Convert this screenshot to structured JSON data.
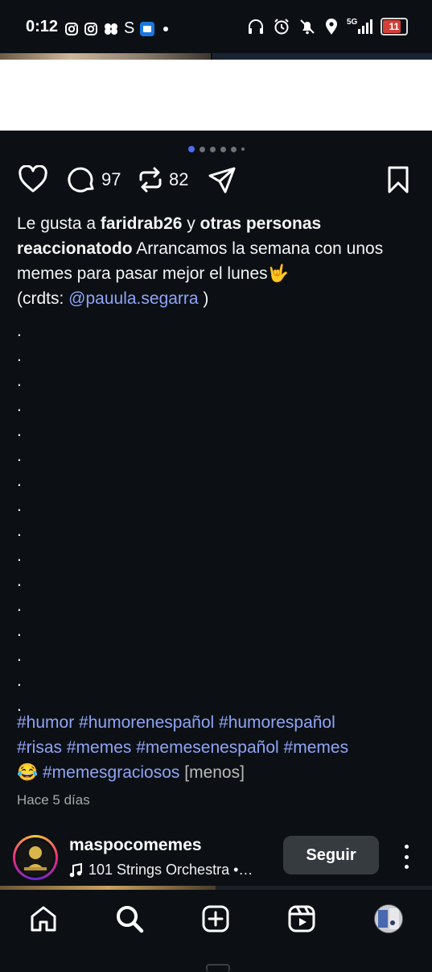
{
  "status_bar": {
    "time": "0:12",
    "left_icons": [
      "instagram-icon",
      "instagram-icon",
      "clover-app-icon",
      "s-app-icon",
      "store-app-icon",
      "dot-icon"
    ],
    "s_glyph": "S",
    "network": "5G",
    "battery": "11",
    "battery_color": "#d2403a"
  },
  "carousel": {
    "count": 6,
    "active_index": 0
  },
  "actions": {
    "comments_count": "97",
    "reposts_count": "82"
  },
  "caption": {
    "liked_prefix": "Le gusta a ",
    "liked_user": "faridrab26",
    "liked_mid": " y ",
    "liked_others": "otras personas",
    "author": "reaccionatodo",
    "text": " Arrancamos la semana con unos memes para pasar mejor el lunes🤟",
    "credits_prefix": "(crdts: ",
    "credits_handle": "@pauula.segarra",
    "credits_suffix": " )",
    "dots": [
      ".",
      ".",
      ".",
      ".",
      ".",
      ".",
      ".",
      ".",
      ".",
      ".",
      ".",
      ".",
      ".",
      ".",
      ".",
      "."
    ],
    "hashtags_line1": [
      "#humor",
      "#humorenespañol",
      "#humorespañol"
    ],
    "hashtags_line2": [
      "#risas",
      "#memes",
      "#memesenespañol",
      "#memes"
    ],
    "emoji": "😂",
    "hashtags_line3": [
      "#memesgraciosos"
    ],
    "less": "[menos]",
    "time_ago": "Hace 5 días"
  },
  "next_post": {
    "username": "maspocomemes",
    "audio": "101 Strings Orchestra •…",
    "follow_label": "Seguir"
  },
  "bottom_nav": [
    "home-icon",
    "search-icon",
    "create-icon",
    "reels-icon",
    "profile-avatar"
  ],
  "colors": {
    "background": "#0c1014",
    "link": "#8fa4f7",
    "active_dot": "#4d6cf3"
  }
}
